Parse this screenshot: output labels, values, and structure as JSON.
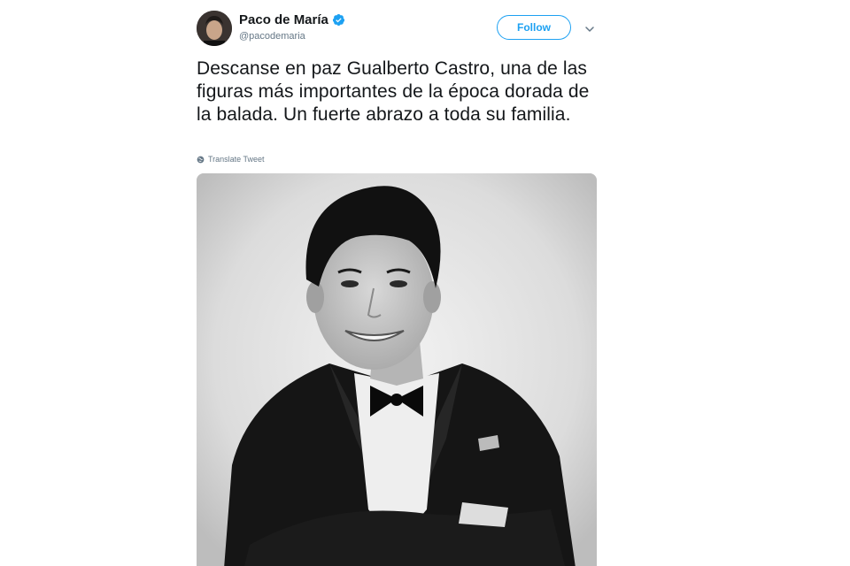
{
  "tweet": {
    "display_name": "Paco de María",
    "handle": "@pacodemaria",
    "follow_label": "Follow",
    "text": "Descanse en paz Gualberto Castro, una de las figuras más importantes de la época dorada de la balada. Un fuerte abrazo a toda su familia.",
    "translate_label": "Translate Tweet"
  },
  "icons": {
    "verified": "verified-badge-icon",
    "menu": "chevron-down-icon",
    "translate": "globe-icon"
  },
  "colors": {
    "accent": "#1da1f2",
    "secondary_text": "#657786",
    "primary_text": "#14171a"
  }
}
